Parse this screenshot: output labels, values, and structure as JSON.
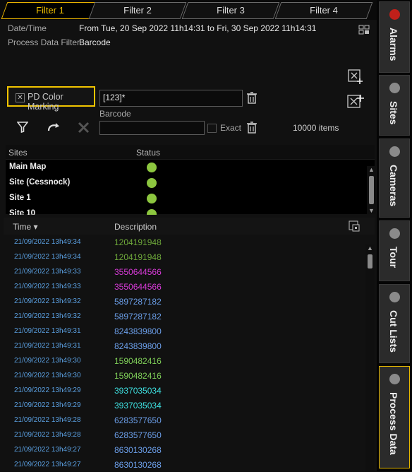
{
  "tabs": [
    "Filter 1",
    "Filter 2",
    "Filter 3",
    "Filter 4"
  ],
  "info": {
    "date_label": "Date/Time",
    "date_value": "From Tue, 20 Sep 2022  11h14:31 to Fri, 30 Sep 2022  11h14:31",
    "pdf_label": "Process Data Filter",
    "pdf_value": "Barcode"
  },
  "pd_color_marking": {
    "label": "PD Color Marking",
    "checked": true
  },
  "pattern_value": "[123]*",
  "barcode_label": "Barcode",
  "exact_label": "Exact",
  "item_count": "10000 items",
  "sites_table": {
    "col_sites": "Sites",
    "col_status": "Status",
    "rows": [
      "Main Map",
      "Site (Cessnock)",
      "Site 1",
      "Site 10"
    ]
  },
  "events_table": {
    "col_time": "Time ▾",
    "col_desc": "Description",
    "rows": [
      {
        "time": "21/09/2022 13h49:34",
        "desc": "1204191948",
        "color": "#6ea83a"
      },
      {
        "time": "21/09/2022 13h49:34",
        "desc": "1204191948",
        "color": "#6ea83a"
      },
      {
        "time": "21/09/2022 13h49:33",
        "desc": "3550644566",
        "color": "#d63ad6"
      },
      {
        "time": "21/09/2022 13h49:33",
        "desc": "3550644566",
        "color": "#d63ad6"
      },
      {
        "time": "21/09/2022 13h49:32",
        "desc": "5897287182",
        "color": "#6b9ee8"
      },
      {
        "time": "21/09/2022 13h49:32",
        "desc": "5897287182",
        "color": "#6b9ee8"
      },
      {
        "time": "21/09/2022 13h49:31",
        "desc": "8243839800",
        "color": "#6b9ee8"
      },
      {
        "time": "21/09/2022 13h49:31",
        "desc": "8243839800",
        "color": "#6b9ee8"
      },
      {
        "time": "21/09/2022 13h49:30",
        "desc": "1590482416",
        "color": "#7fcf58"
      },
      {
        "time": "21/09/2022 13h49:30",
        "desc": "1590482416",
        "color": "#7fcf58"
      },
      {
        "time": "21/09/2022 13h49:29",
        "desc": "3937035034",
        "color": "#3ee0e0"
      },
      {
        "time": "21/09/2022 13h49:29",
        "desc": "3937035034",
        "color": "#3ee0e0"
      },
      {
        "time": "21/09/2022 13h49:28",
        "desc": "6283577650",
        "color": "#6b9ee8"
      },
      {
        "time": "21/09/2022 13h49:28",
        "desc": "6283577650",
        "color": "#6b9ee8"
      },
      {
        "time": "21/09/2022 13h49:27",
        "desc": "8630130268",
        "color": "#6b9ee8"
      },
      {
        "time": "21/09/2022 13h49:27",
        "desc": "8630130268",
        "color": "#6b9ee8"
      }
    ]
  },
  "side_tabs": [
    {
      "label": "Alarms",
      "led": "#c0201a"
    },
    {
      "label": "Sites",
      "led": "#8a8a8a"
    },
    {
      "label": "Cameras",
      "led": "#8a8a8a"
    },
    {
      "label": "Tour",
      "led": "#8a8a8a"
    },
    {
      "label": "Cut Lists",
      "led": "#8a8a8a"
    },
    {
      "label": "Process Data",
      "led": "#8a8a8a"
    }
  ]
}
